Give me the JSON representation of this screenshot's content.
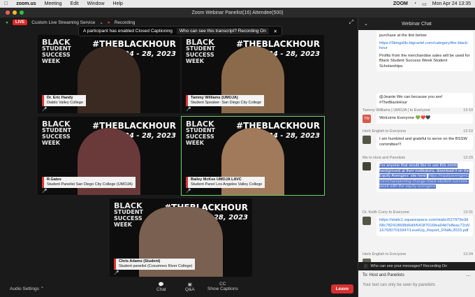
{
  "menubar": {
    "app": "zoom.us",
    "items": [
      "Meeting",
      "Edit",
      "Window",
      "Help"
    ],
    "status_app": "ZOOM",
    "datetime": "Mon Apr 24  13:35"
  },
  "window": {
    "title": "Zoom Webinar Panelist(16)  Attendee(500)"
  },
  "topbar": {
    "live": "LIVE",
    "stream": "Custom Live Streaming Service",
    "recording": "Recording"
  },
  "banner": {
    "text": "A participant has enabled Closed Captioning",
    "link": "Who can see this transcript? Recording On"
  },
  "tiles": [
    {
      "name": "Dr. Eric Handy",
      "org": "Diablo Valley College"
    },
    {
      "name": "Tammy Williams (UMOJA)",
      "org": "Student Speaker- San Diego City College"
    },
    {
      "name": "R.Gates",
      "org": "Student Panelist San Diego City College (UMOJA)"
    },
    {
      "name": "Bailey McKee UMOJA LAVC",
      "org": "Student Panel Los Angeles Valley College"
    },
    {
      "name": "Chris Adams (Student)",
      "org": "Student panelist (Cosumnes River College)"
    }
  ],
  "background": {
    "brand_line1": "BLACK",
    "brand_line2": "STUDENT",
    "brand_line3": "SUCCESS",
    "brand_line4": "WEEK",
    "hashtag": "#THEBLACKHOUR",
    "dates": "April 24 - 28, 2023"
  },
  "bottombar": {
    "audio": "Audio Settings",
    "chat": "Chat",
    "qa": "Q&A",
    "captions": "Show Captions",
    "leave": "Leave"
  },
  "chat": {
    "title": "Webinar Chat",
    "m0_text": "purchase at the link below:",
    "m0_link": "https://3kingsllls.bigcartel.com/category/the-black-hour",
    "m0_text2": "Profits from the merchandise sales will be used for Black Student Success Week Student Scholarships.",
    "m1_text": "@Jeante We can because you are! #TheBlackHour",
    "m2_sender": "Tammy Williams | UMOJA | to Everyone",
    "m2_time": "13:10",
    "m2_text": "Welcome Everyone 💚❤️🖤",
    "m3_sender": "Herb English to Everyone",
    "m3_time": "13:10",
    "m3_text": "I am humbled and grateful to serve on the BSSW committee!!!",
    "m4_sender": "Me to Host and Panelists",
    "m4_time": "13:29",
    "m4_text": "For anyone that would like to use this zoom background at their institutions, download it on the Equity Avengers' site here:",
    "m4_link": "https://equityavengers.com/championing-change-black-student-success-week-with-the-equity-avengers/",
    "m5_sender": "Dr. Keith Curry to Everyone",
    "m5_time": "13:31",
    "m5_link": "https://static1.squarespace.com/static/627979e3d58c782418608d6d/t/64187016fea04d7e8eac72c6/1679307015947/LevelUp_Report_FINAL2023.pdf",
    "m6_sender": "Herb English to Everyone",
    "m6_time": "13:34",
    "status": "Who can see your messages? Recording On",
    "to": "To: Host and Panelists",
    "input_placeholder": "Your text can only be seen by panelists"
  },
  "colors": {
    "live": "#e02828",
    "leave": "#d63030",
    "active_border": "#6ad06a",
    "selection": "#5876c7"
  }
}
